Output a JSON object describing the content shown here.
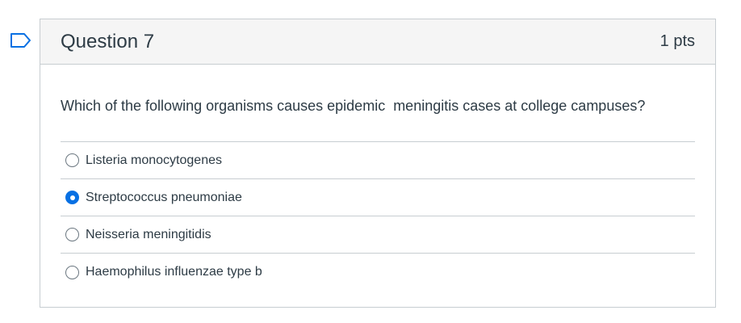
{
  "question": {
    "title": "Question 7",
    "points": "1 pts",
    "text": "Which of the following organisms causes epidemic  meningitis cases at college campuses?",
    "answers": [
      {
        "label": "Listeria monocytogenes",
        "selected": false
      },
      {
        "label": "Streptococcus pneumoniae",
        "selected": true
      },
      {
        "label": "Neisseria meningitidis",
        "selected": false
      },
      {
        "label": "Haemophilus influenzae type b",
        "selected": false
      }
    ]
  },
  "icons": {
    "flag": "flag-question-icon"
  },
  "colors": {
    "accent": "#0770e3",
    "border": "#c7cdd1",
    "header_bg": "#f5f5f5"
  }
}
